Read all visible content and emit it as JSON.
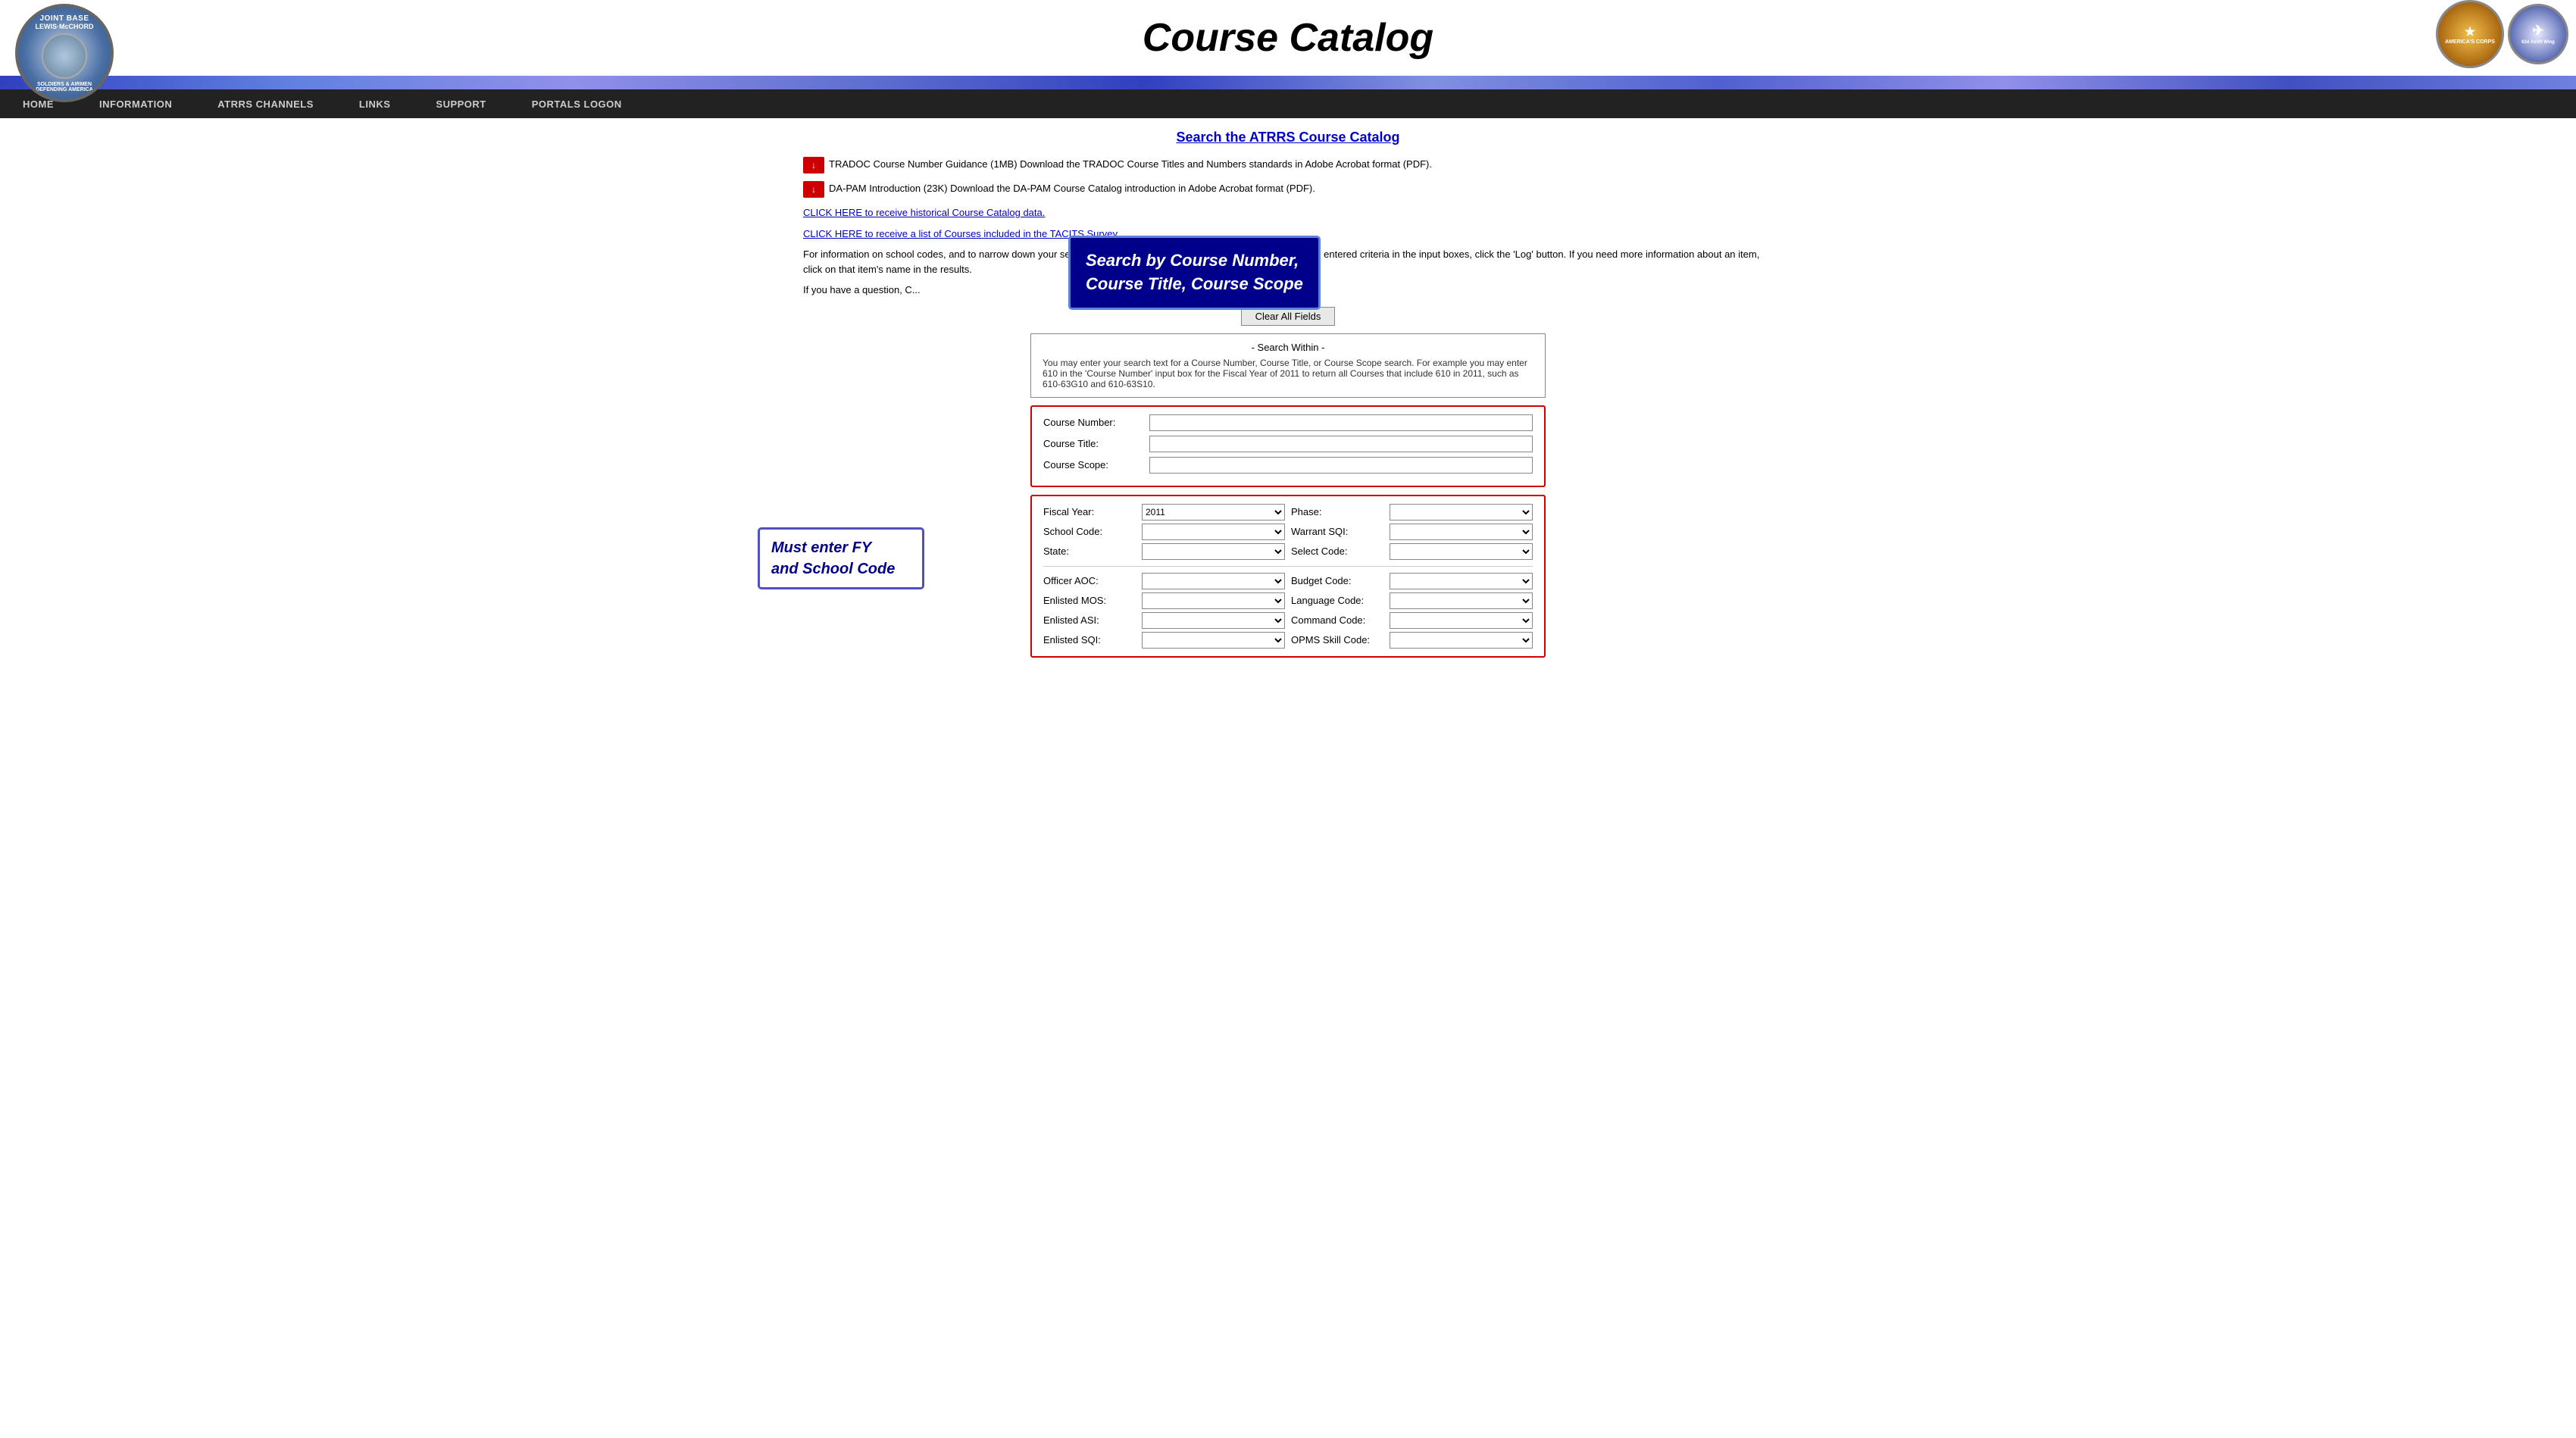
{
  "header": {
    "title": "Course Catalog",
    "logo_jblm_alt": "Joint Base Lewis-McChord",
    "logo_right_alt": "Army logos"
  },
  "nav": {
    "items": [
      {
        "id": "home",
        "label": "HOME"
      },
      {
        "id": "information",
        "label": "INFORMATION"
      },
      {
        "id": "atrrs_channels",
        "label": "ATRRS CHANNELS"
      },
      {
        "id": "links",
        "label": "LINKS"
      },
      {
        "id": "support",
        "label": "SUPPORT"
      },
      {
        "id": "portals_logon",
        "label": "PORTALS LOGON"
      }
    ]
  },
  "main": {
    "page_title": "Search the ATRRS Course Catalog",
    "tradoc_line": "TRADOC Course Number Guidance (1MB)  Download the TRADOC Course Titles and Numbers standards in Adobe Acrobat format (PDF).",
    "dapam_line": "DA-PAM Introduction (23K)  Download the DA-PAM Course Catalog introduction in Adobe Acrobat format (PDF).",
    "click_here_1": "CLICK HERE to receive historical Course Catalog data.",
    "click_here_2": "CLICK HERE to receive a list of Courses included in the TACITS Survey.",
    "info_para": "For information on school codes, and to narrow down your search, it is possible to specify your search. When you have entered criteria in the input boxes, click the 'Log' button. If you need more information about an item, click on that item's name in the results.",
    "question_line": "If you have a question, C...",
    "tooltip": {
      "text": "Search by Course Number,\nCourse Title, Course Scope"
    },
    "clear_button": "Clear All Fields",
    "search_within": {
      "title": "- Search Within -",
      "description": "You may enter your search text for a Course Number, Course Title, or Course Scope search. For example you may enter 610 in the 'Course Number' input box for the Fiscal Year of 2011 to return all Courses that include 610 in 2011, such as 610-63G10 and 610-63S10."
    },
    "form": {
      "course_number_label": "Course Number:",
      "course_title_label": "Course Title:",
      "course_scope_label": "Course Scope:",
      "fiscal_year_label": "Fiscal Year:",
      "fiscal_year_value": "2011",
      "school_code_label": "School Code:",
      "state_label": "State:",
      "phase_label": "Phase:",
      "warrant_sqi_label": "Warrant SQI:",
      "select_code_label": "Select Code:",
      "officer_aoc_label": "Officer AOC:",
      "budget_code_label": "Budget Code:",
      "enlisted_mos_label": "Enlisted MOS:",
      "language_code_label": "Language Code:",
      "enlisted_asi_label": "Enlisted ASI:",
      "command_code_label": "Command Code:",
      "enlisted_sqi_label": "Enlisted SQI:",
      "opms_skill_label": "OPMS Skill Code:"
    },
    "must_enter": {
      "text": "Must enter FY and School Code"
    }
  }
}
